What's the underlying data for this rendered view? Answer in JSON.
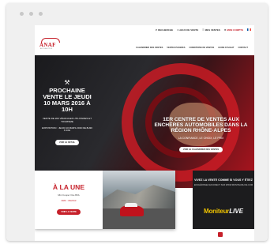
{
  "topbar": {
    "items": [
      "RECHERCHE",
      "LIEUX DE VENTE",
      "MES VENTES"
    ],
    "account": "MON COMPTE"
  },
  "logo": {
    "name": "ANAF",
    "subtitle": "AUTO-AUCTION"
  },
  "nav": {
    "items": [
      "CALENDRIER DES VENTES",
      "VENTES PASSÉES",
      "CONDITIONS DE VENTES",
      "GUIDE D'ACHAT",
      "CONTACT"
    ]
  },
  "hero": {
    "headline": "PROCHAINE VENTE LE JEUDI 10 MARS 2016 À 10H",
    "description": "VENTE DE 200 VÉHICULES UTILITAIRES ET TOURISME",
    "exposition": "EXPOSITION : JEUDI 10 MARS 2016 DE 8H30 À 10H",
    "cta_detail": "VOIR LE DÉTAIL",
    "right_headline": "1ER CENTRE DE VENTES AUX ENCHÈRES AUTOMOBILES DANS LA RÉGION RHÔNE-ALPES",
    "right_tagline": "LA CONFIANCE, LE CHOIX, LE PRIX",
    "cta_calendar": "VOIR LE CALENDRIER DES VENTES"
  },
  "une": {
    "title": "À LA UNE",
    "text": "Mini Cooper One BVA",
    "meta": "DMC : 06/2013",
    "cta": "VOIR LA VENTE"
  },
  "vivez": {
    "title": "VIVEZ LA VENTE COMME SI VOUS Y ÉTIEZ",
    "text": "ENCHÉRISSEZ EN DIRECT SUR WWW.MONITEURLIVE.COM",
    "brand_a": "Moniteur",
    "brand_b": "LIVE"
  },
  "colors": {
    "accent": "#c6202a",
    "dark": "#1c1c1e"
  }
}
